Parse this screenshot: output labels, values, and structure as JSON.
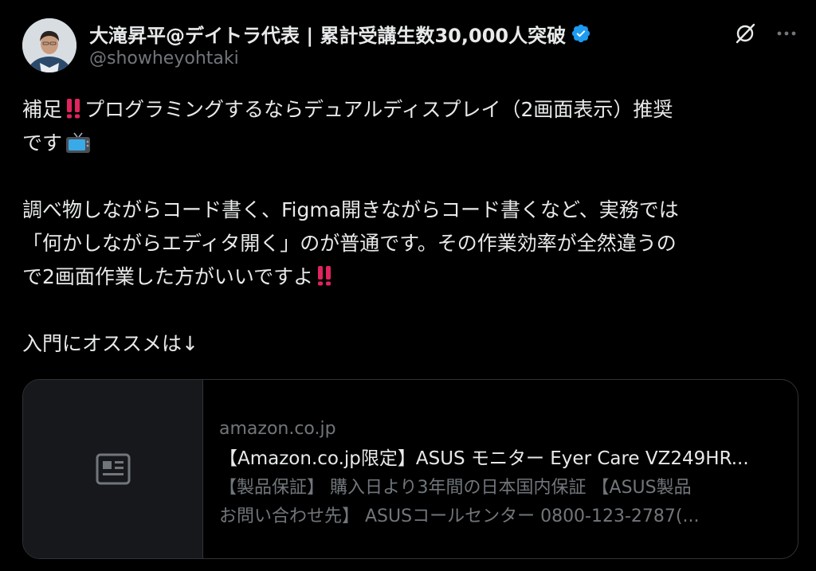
{
  "author": {
    "display_name": "大滝昇平@デイトラ代表 | 累計受講生数30,000人突破",
    "handle": "@showheyohtaki",
    "verified": true
  },
  "header": {
    "icons": [
      "grok-icon",
      "more-icon"
    ]
  },
  "tweet": {
    "para1": {
      "line1_a": "補足",
      "line1_b": "プログラミングするならデュアルディスプレイ（2画面表示）推奨",
      "line2": "です"
    },
    "para2": {
      "line1": "調べ物しながらコード書く、Figma開きながらコード書くなど、実務では",
      "line2": "「何かしながらエディタ開く」のが普通です。その作業効率が全然違うの",
      "line3": "で2画面作業した方がいいですよ"
    },
    "para3": {
      "line1": "入門にオススメは↓"
    }
  },
  "card": {
    "domain": "amazon.co.jp",
    "title": "【Amazon.co.jp限定】ASUS モニター Eyer Care VZ249HR...",
    "desc_line1": "【製品保証】 購入日より3年間の日本国内保証 【ASUS製品",
    "desc_line2": "お問い合わせ先】 ASUSコールセンター 0800-123-2787(..."
  },
  "colors": {
    "background": "#000000",
    "text_primary": "#e7e9ea",
    "text_secondary": "#71767b",
    "border": "#2f3336",
    "verified_blue": "#1d9bf0",
    "bangbang_red": "#e0245e"
  }
}
